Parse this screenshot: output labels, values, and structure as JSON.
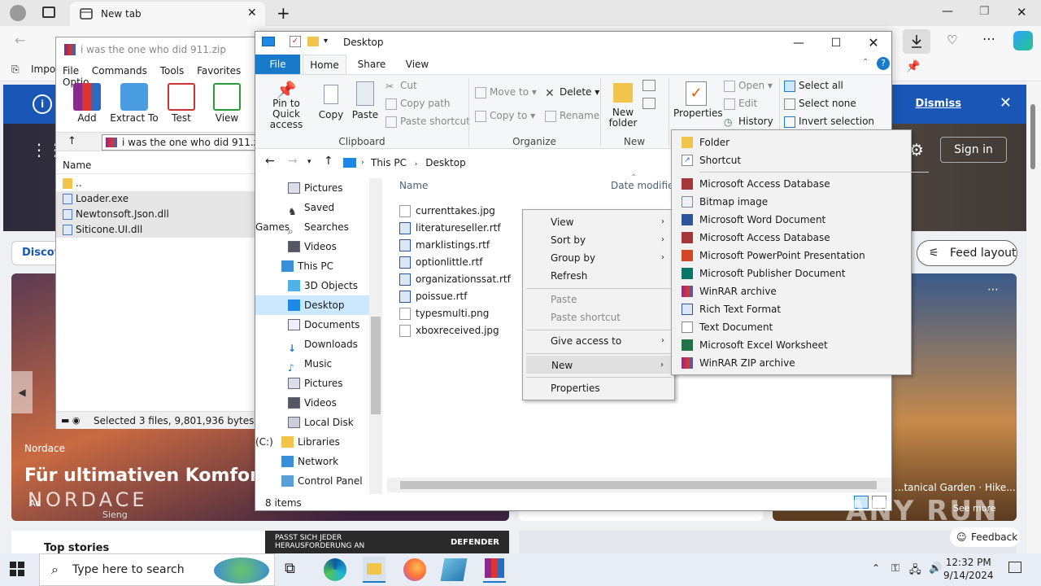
{
  "browser": {
    "tab_title": "New tab",
    "fav_text": "Impor",
    "window_controls": [
      "—",
      "❐",
      "✕"
    ]
  },
  "msn": {
    "dismiss": "Dismiss",
    "sign_in": "Sign in",
    "discover": "Discov",
    "feed_layout": "Feed layout",
    "card_brand": "Nordace",
    "card_headline": "Für ultimativen Komfort",
    "card_logo": "NORDACE",
    "card_ad": "Ad",
    "card_sub": "Sieng",
    "right_caption": "...tanical Garden · Hike...",
    "see_more": "See more",
    "top_stories": "Top stories",
    "bottom_ad_line1": "PASST SICH JEDER",
    "bottom_ad_line2": "HERAUSFORDERUNG AN",
    "bottom_ad_brand": "DEFENDER",
    "feedback": "Feedback"
  },
  "winrar": {
    "title": "i was the one who did 911.zip",
    "menu": [
      "File",
      "Commands",
      "Tools",
      "Favorites",
      "Optio"
    ],
    "tools": [
      "Add",
      "Extract To",
      "Test",
      "View"
    ],
    "path": "i was the one who did 911.zip -",
    "col_name": "Name",
    "rows": [
      "..",
      "Loader.exe",
      "Newtonsoft.Json.dll",
      "Siticone.UI.dll"
    ],
    "status": "Selected 3 files, 9,801,936 bytes"
  },
  "explorer": {
    "title": "Desktop",
    "tabs": [
      "File",
      "Home",
      "Share",
      "View"
    ],
    "ribbon": {
      "pin": "Pin to Quick access",
      "copy": "Copy",
      "paste": "Paste",
      "cut": "Cut",
      "copy_path": "Copy path",
      "paste_shortcut": "Paste shortcut",
      "clipboard": "Clipboard",
      "move_to": "Move to",
      "copy_to": "Copy to",
      "delete": "Delete",
      "rename": "Rename",
      "organize": "Organize",
      "new_folder": "New folder",
      "new": "New",
      "properties": "Properties",
      "open": "Open",
      "edit": "Edit",
      "history": "History",
      "select_all": "Select all",
      "select_none": "Select none",
      "invert_selection": "Invert selection"
    },
    "breadcrumb": [
      "This PC",
      "Desktop"
    ],
    "nav": [
      "Pictures",
      "Saved Games",
      "Searches",
      "Videos",
      "This PC",
      "3D Objects",
      "Desktop",
      "Documents",
      "Downloads",
      "Music",
      "Pictures",
      "Videos",
      "Local Disk (C:)",
      "Libraries",
      "Network",
      "Control Panel"
    ],
    "col_name": "Name",
    "col_date": "Date modified",
    "files": [
      "currenttakes.jpg",
      "literatureseller.rtf",
      "marklistings.rtf",
      "optionlittle.rtf",
      "organizationssat.rtf",
      "poissue.rtf",
      "typesmulti.png",
      "xboxreceived.jpg"
    ],
    "status": "8 items"
  },
  "context_menu": {
    "items": [
      "View",
      "Sort by",
      "Group by",
      "Refresh",
      "Paste",
      "Paste shortcut",
      "Give access to",
      "New",
      "Properties"
    ]
  },
  "new_submenu": {
    "items": [
      "Folder",
      "Shortcut",
      "Microsoft Access Database",
      "Bitmap image",
      "Microsoft Word Document",
      "Microsoft Access Database",
      "Microsoft PowerPoint Presentation",
      "Microsoft Publisher Document",
      "WinRAR archive",
      "Rich Text Format",
      "Text Document",
      "Microsoft Excel Worksheet",
      "WinRAR ZIP archive"
    ]
  },
  "taskbar": {
    "search_placeholder": "Type here to search",
    "time": "12:32 PM",
    "date": "9/14/2024"
  },
  "watermark": "ANY RUN"
}
